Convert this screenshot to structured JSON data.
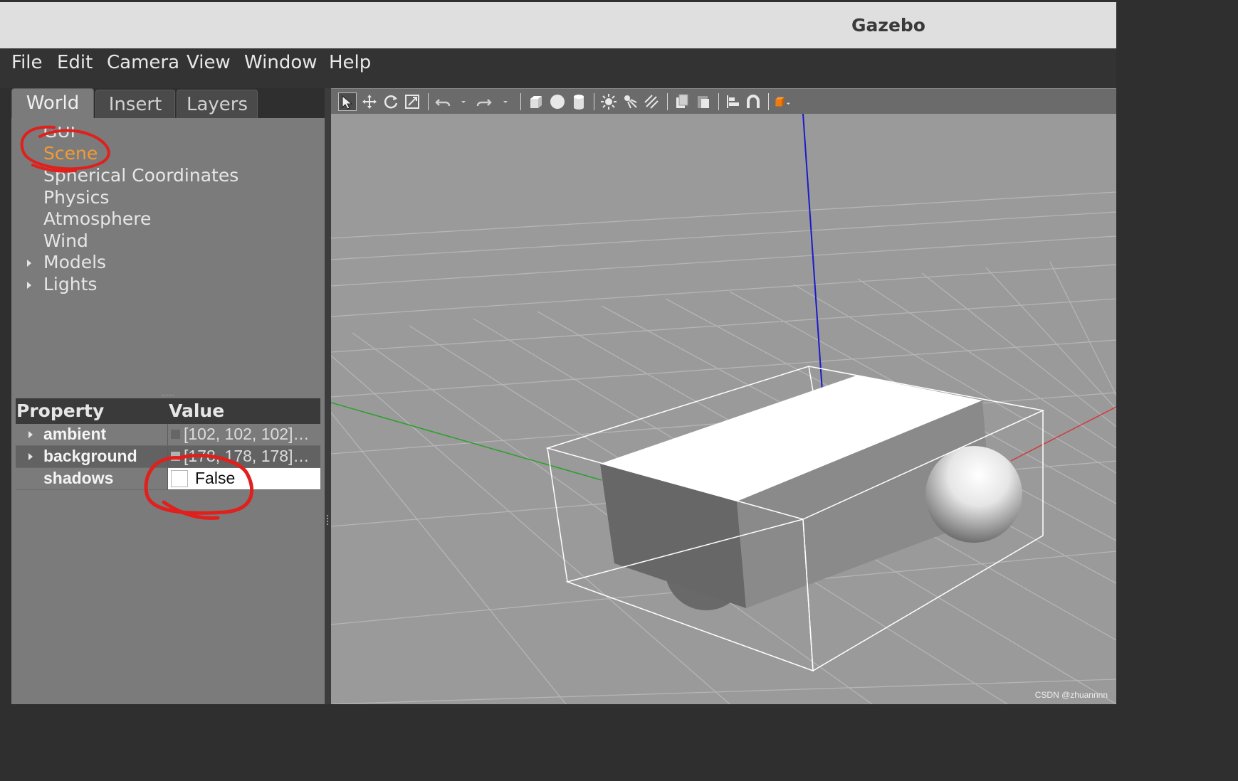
{
  "window": {
    "title": "Gazebo"
  },
  "menubar": {
    "items": [
      {
        "label": "File"
      },
      {
        "label": "Edit"
      },
      {
        "label": "Camera"
      },
      {
        "label": "View"
      },
      {
        "label": "Window"
      },
      {
        "label": "Help"
      }
    ]
  },
  "left_panel": {
    "tabs": [
      {
        "label": "World",
        "active": true
      },
      {
        "label": "Insert",
        "active": false
      },
      {
        "label": "Layers",
        "active": false
      }
    ],
    "tree": [
      {
        "label": "GUI",
        "expandable": false,
        "selected": false
      },
      {
        "label": "Scene",
        "expandable": false,
        "selected": true
      },
      {
        "label": "Spherical Coordinates",
        "expandable": false,
        "selected": false
      },
      {
        "label": "Physics",
        "expandable": false,
        "selected": false
      },
      {
        "label": "Atmosphere",
        "expandable": false,
        "selected": false
      },
      {
        "label": "Wind",
        "expandable": false,
        "selected": false
      },
      {
        "label": "Models",
        "expandable": true,
        "selected": false
      },
      {
        "label": "Lights",
        "expandable": true,
        "selected": false
      }
    ],
    "properties": {
      "headers": {
        "property": "Property",
        "value": "Value"
      },
      "rows": [
        {
          "name": "ambient",
          "value": "[102, 102, 102]…",
          "swatch": "#666666",
          "expandable": true
        },
        {
          "name": "background",
          "value": "[178, 178, 178]…",
          "swatch": "#b2b2b2",
          "expandable": true
        },
        {
          "name": "shadows",
          "value": "False",
          "checked": false,
          "expandable": false
        }
      ]
    }
  },
  "toolbar": {
    "tools": [
      "select-mode-icon",
      "translate-mode-icon",
      "rotate-mode-icon",
      "scale-mode-icon",
      "undo-icon",
      "undo-dropdown-icon",
      "redo-icon",
      "redo-dropdown-icon",
      "box-shape-icon",
      "sphere-shape-icon",
      "cylinder-shape-icon",
      "point-light-icon",
      "spot-light-icon",
      "directional-light-icon",
      "copy-icon",
      "paste-icon",
      "align-icon",
      "snap-icon",
      "view-angle-icon"
    ]
  },
  "viewport": {
    "colors": {
      "background": "#9a9a9a",
      "grid": "#b5b5b5",
      "axis_x": "#d23a3a",
      "axis_y": "#2aa02a",
      "axis_z": "#1a1acc",
      "selection_outline": "#ffffff"
    },
    "model": {
      "parts": [
        "chassis-box",
        "caster-sphere",
        "wheel"
      ]
    }
  },
  "watermark": "CSDN @zhuannnn",
  "colors": {
    "selected_text": "#f39a35",
    "panel_bg": "#7b7b7b",
    "titlebar_bg": "#dfdfdf",
    "menubar_bg": "#333333"
  }
}
